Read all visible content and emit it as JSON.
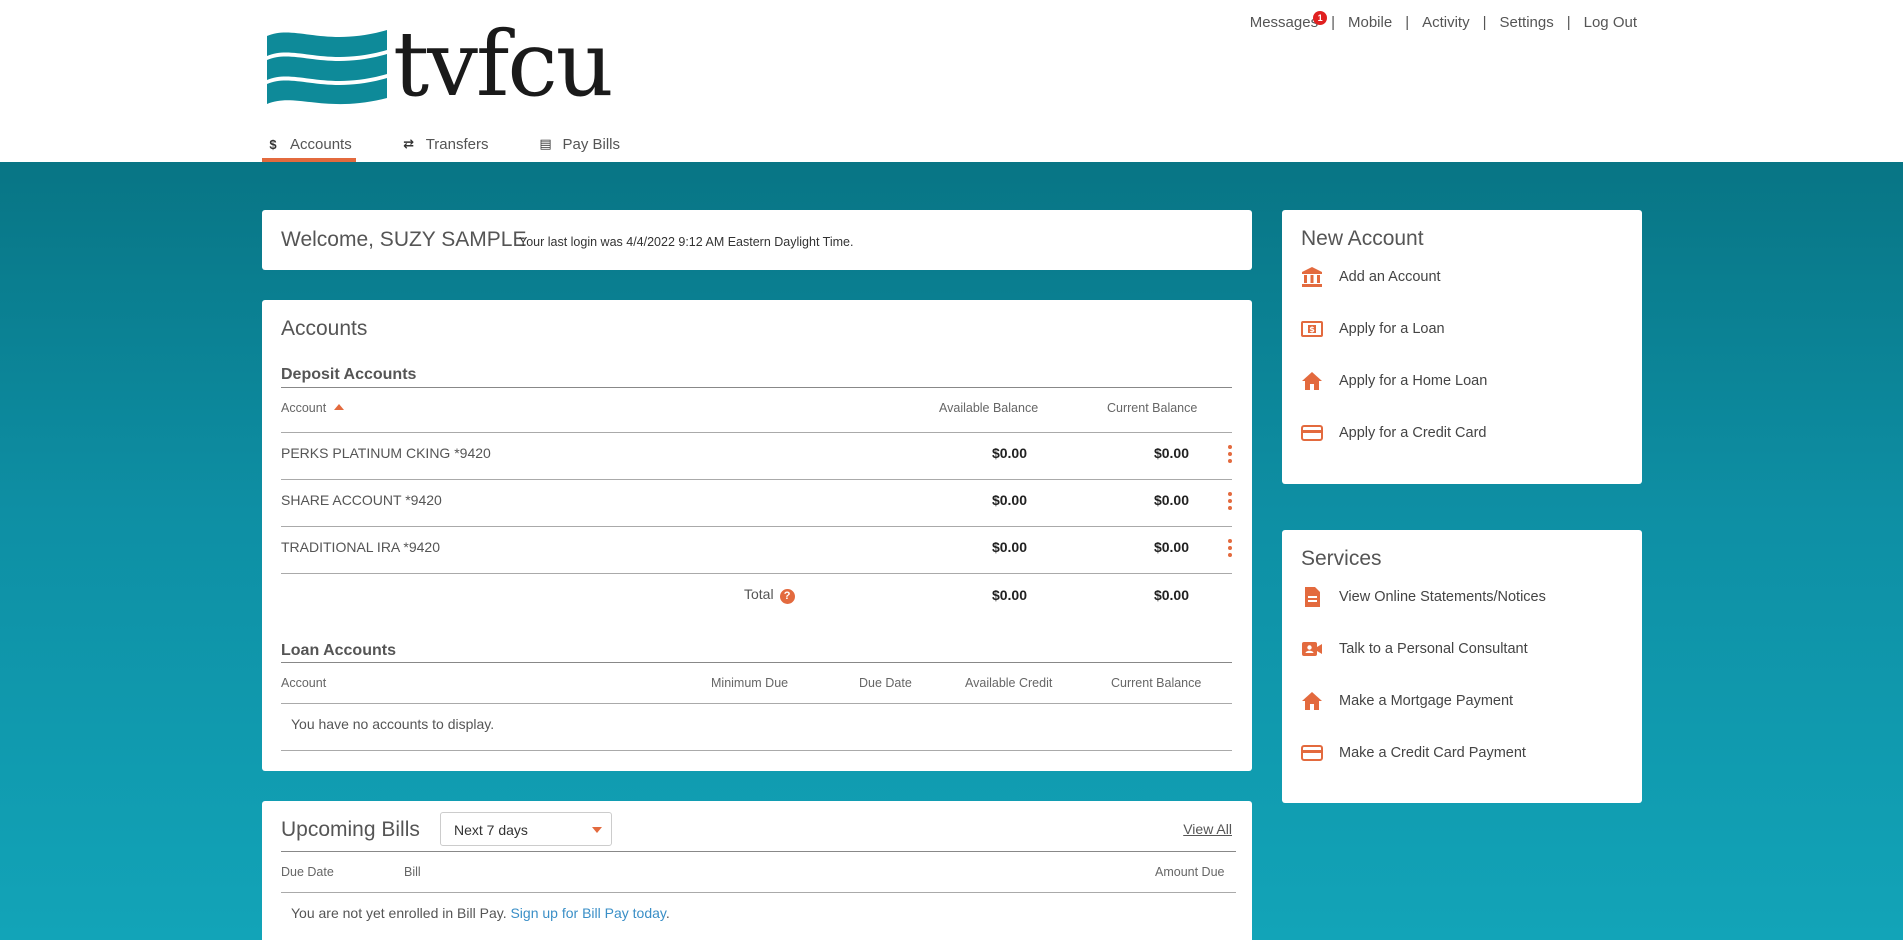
{
  "brand": {
    "logo_text": "tvfcu",
    "accent": "#e36a3e",
    "teal": "#0e8fa4"
  },
  "topnav": {
    "messages": "Messages",
    "messages_badge": "1",
    "mobile": "Mobile",
    "activity": "Activity",
    "settings": "Settings",
    "logout": "Log Out",
    "separator": "|"
  },
  "mainnav": {
    "accounts": {
      "icon": "$",
      "label": "Accounts"
    },
    "transfers": {
      "icon": "⇄",
      "label": "Transfers"
    },
    "paybills": {
      "icon": "▤",
      "label": "Pay Bills"
    }
  },
  "welcome": {
    "title": "Welcome, SUZY SAMPLE",
    "last_login": "Your last login was 4/4/2022 9:12 AM Eastern Daylight Time."
  },
  "accounts": {
    "title": "Accounts",
    "deposit": {
      "title": "Deposit Accounts",
      "col_account": "Account",
      "col_available": "Available Balance",
      "col_current": "Current Balance",
      "rows": [
        {
          "name": "PERKS PLATINUM CKING  *9420",
          "available": "$0.00",
          "current": "$0.00"
        },
        {
          "name": "SHARE ACCOUNT  *9420",
          "available": "$0.00",
          "current": "$0.00"
        },
        {
          "name": "TRADITIONAL IRA  *9420",
          "available": "$0.00",
          "current": "$0.00"
        }
      ],
      "total_label": "Total",
      "total_help": "?",
      "total_available": "$0.00",
      "total_current": "$0.00"
    },
    "loan": {
      "title": "Loan Accounts",
      "col_account": "Account",
      "col_min_due": "Minimum Due",
      "col_due_date": "Due Date",
      "col_available_credit": "Available Credit",
      "col_current": "Current Balance",
      "empty": "You have no accounts to display."
    }
  },
  "bills": {
    "title": "Upcoming Bills",
    "range": "Next 7 days",
    "view_all": "View All",
    "col_due_date": "Due Date",
    "col_bill": "Bill",
    "col_amount": "Amount Due",
    "not_enrolled": "You are not yet enrolled in Bill Pay. ",
    "signup_link": "Sign up for Bill Pay today",
    "period": "."
  },
  "new_account": {
    "title": "New Account",
    "items": [
      {
        "label": "Add an Account",
        "icon": "bank-icon"
      },
      {
        "label": "Apply for a Loan",
        "icon": "money-icon"
      },
      {
        "label": "Apply for a Home Loan",
        "icon": "home-icon"
      },
      {
        "label": "Apply for a Credit Card",
        "icon": "credit-card-icon"
      }
    ]
  },
  "services": {
    "title": "Services",
    "items": [
      {
        "label": "View Online Statements/Notices",
        "icon": "document-icon"
      },
      {
        "label": "Talk to a Personal Consultant",
        "icon": "video-contact-icon"
      },
      {
        "label": "Make a Mortgage Payment",
        "icon": "home-icon"
      },
      {
        "label": "Make a Credit Card Payment",
        "icon": "credit-card-icon"
      }
    ]
  }
}
